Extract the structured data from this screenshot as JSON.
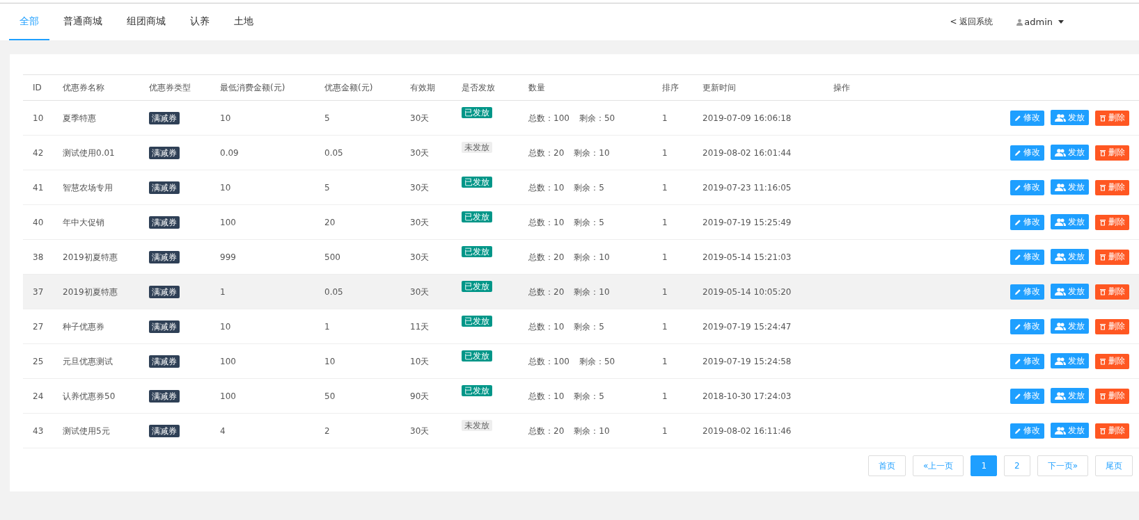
{
  "tabs": [
    {
      "label": "全部",
      "selected": true
    },
    {
      "label": "普通商城",
      "selected": false
    },
    {
      "label": "组团商城",
      "selected": false
    },
    {
      "label": "认养",
      "selected": false
    },
    {
      "label": "土地",
      "selected": false
    }
  ],
  "header_right": {
    "back": "< 返回系统",
    "user": "admin"
  },
  "table": {
    "columns": [
      "ID",
      "优惠券名称",
      "优惠券类型",
      "最低消费金额(元)",
      "优惠金额(元)",
      "有效期",
      "是否发放",
      "数量",
      "排序",
      "更新时间",
      "操作"
    ],
    "rows": [
      {
        "id": "10",
        "name": "夏季特惠",
        "type": "满减券",
        "min": "10",
        "discount": "5",
        "valid": "30天",
        "issued": true,
        "issued_label": "已发放",
        "total": "总数：100",
        "remain": "剩余：50",
        "sort": "1",
        "time": "2019-07-09 16:06:18",
        "highlighted": false,
        "actions": [
          {
            "kind": "edit",
            "label": "修改"
          },
          {
            "kind": "issue",
            "label": "发放"
          },
          {
            "kind": "delete",
            "label": "删除"
          }
        ]
      },
      {
        "id": "42",
        "name": "测试使用0.01",
        "type": "满减券",
        "min": "0.09",
        "discount": "0.05",
        "valid": "30天",
        "issued": false,
        "issued_label": "未发放",
        "total": "总数：20",
        "remain": "剩余：10",
        "sort": "1",
        "time": "2019-08-02 16:01:44",
        "highlighted": false,
        "actions": [
          {
            "kind": "edit",
            "label": "修改"
          },
          {
            "kind": "issue",
            "label": "发放"
          },
          {
            "kind": "delete",
            "label": "删除"
          }
        ]
      },
      {
        "id": "41",
        "name": "智慧农场专用",
        "type": "满减券",
        "min": "10",
        "discount": "5",
        "valid": "30天",
        "issued": true,
        "issued_label": "已发放",
        "total": "总数：10",
        "remain": "剩余：5",
        "sort": "1",
        "time": "2019-07-23 11:16:05",
        "highlighted": false,
        "actions": [
          {
            "kind": "edit",
            "label": "修改"
          },
          {
            "kind": "issue",
            "label": "发放"
          },
          {
            "kind": "delete",
            "label": "删除"
          }
        ]
      },
      {
        "id": "40",
        "name": "年中大促销",
        "type": "满减券",
        "min": "100",
        "discount": "20",
        "valid": "30天",
        "issued": true,
        "issued_label": "已发放",
        "total": "总数：10",
        "remain": "剩余：5",
        "sort": "1",
        "time": "2019-07-19 15:25:49",
        "highlighted": false,
        "actions": [
          {
            "kind": "edit",
            "label": "修改"
          },
          {
            "kind": "issue",
            "label": "发放"
          },
          {
            "kind": "delete",
            "label": "删除"
          }
        ]
      },
      {
        "id": "38",
        "name": "2019初夏特惠",
        "type": "满减券",
        "min": "999",
        "discount": "500",
        "valid": "30天",
        "issued": true,
        "issued_label": "已发放",
        "total": "总数：20",
        "remain": "剩余：10",
        "sort": "1",
        "time": "2019-05-14 15:21:03",
        "highlighted": false,
        "actions": [
          {
            "kind": "edit",
            "label": "修改"
          },
          {
            "kind": "issue",
            "label": "发放"
          },
          {
            "kind": "delete",
            "label": "删除"
          }
        ]
      },
      {
        "id": "37",
        "name": "2019初夏特惠",
        "type": "满减券",
        "min": "1",
        "discount": "0.05",
        "valid": "30天",
        "issued": true,
        "issued_label": "已发放",
        "total": "总数：20",
        "remain": "剩余：10",
        "sort": "1",
        "time": "2019-05-14 10:05:20",
        "highlighted": true,
        "actions": [
          {
            "kind": "edit",
            "label": "修改"
          },
          {
            "kind": "issue",
            "label": "发放"
          },
          {
            "kind": "delete",
            "label": "删除"
          }
        ]
      },
      {
        "id": "27",
        "name": "种子优惠券",
        "type": "满减券",
        "min": "10",
        "discount": "1",
        "valid": "11天",
        "issued": true,
        "issued_label": "已发放",
        "total": "总数：10",
        "remain": "剩余：5",
        "sort": "1",
        "time": "2019-07-19 15:24:47",
        "highlighted": false,
        "actions": [
          {
            "kind": "edit",
            "label": "修改"
          },
          {
            "kind": "issue",
            "label": "发放"
          },
          {
            "kind": "delete",
            "label": "删除"
          }
        ]
      },
      {
        "id": "25",
        "name": "元旦优惠测试",
        "type": "满减券",
        "min": "100",
        "discount": "10",
        "valid": "10天",
        "issued": true,
        "issued_label": "已发放",
        "total": "总数：100",
        "remain": "剩余：50",
        "sort": "1",
        "time": "2019-07-19 15:24:58",
        "highlighted": false,
        "actions": [
          {
            "kind": "edit",
            "label": "修改"
          },
          {
            "kind": "issue",
            "label": "发放"
          },
          {
            "kind": "delete",
            "label": "删除"
          }
        ]
      },
      {
        "id": "24",
        "name": "认养优惠券50",
        "type": "满减券",
        "min": "100",
        "discount": "50",
        "valid": "90天",
        "issued": true,
        "issued_label": "已发放",
        "total": "总数：10",
        "remain": "剩余：5",
        "sort": "1",
        "time": "2018-10-30 17:24:03",
        "highlighted": false,
        "actions": [
          {
            "kind": "edit",
            "label": "修改"
          },
          {
            "kind": "issue",
            "label": "发放"
          },
          {
            "kind": "delete",
            "label": "删除"
          }
        ]
      },
      {
        "id": "43",
        "name": "测试使用5元",
        "type": "满减券",
        "min": "4",
        "discount": "2",
        "valid": "30天",
        "issued": false,
        "issued_label": "未发放",
        "total": "总数：20",
        "remain": "剩余：10",
        "sort": "1",
        "time": "2019-08-02 16:11:46",
        "highlighted": false,
        "actions": [
          {
            "kind": "edit",
            "label": "修改"
          },
          {
            "kind": "issue",
            "label": "发放"
          },
          {
            "kind": "delete",
            "label": "删除"
          }
        ]
      }
    ]
  },
  "pagination": [
    {
      "label": "首页",
      "selected": false
    },
    {
      "label": "«上一页",
      "selected": false
    },
    {
      "label": "1",
      "selected": true
    },
    {
      "label": "2",
      "selected": false
    },
    {
      "label": "下一页»",
      "selected": false
    },
    {
      "label": "尾页",
      "selected": false
    }
  ]
}
